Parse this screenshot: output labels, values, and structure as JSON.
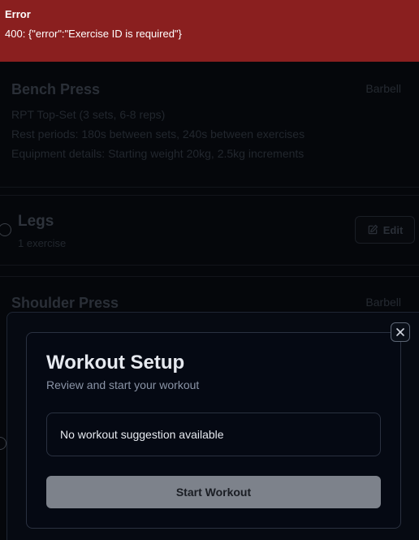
{
  "error_toast": {
    "title": "Error",
    "message": "400: {\"error\":\"Exercise ID is required\"}",
    "color": "#8a1f1f"
  },
  "background": {
    "exercise_1": {
      "name": "Bench Press",
      "equipment": "Barbell",
      "details": [
        "RPT Top-Set (3 sets, 6-8 reps)",
        "Rest periods: 180s between sets, 240s between exercises",
        "Equipment details: Starting weight 20kg, 2.5kg increments"
      ]
    },
    "group": {
      "name": "Legs",
      "count": "1 exercise",
      "edit_label": "Edit"
    },
    "exercise_2": {
      "name": "Shoulder Press",
      "equipment": "Barbell"
    }
  },
  "modal": {
    "title": "Workout Setup",
    "subtitle": "Review and start your workout",
    "suggestion_text": "No workout suggestion available",
    "start_label": "Start Workout"
  },
  "icons": {
    "close": "close-icon",
    "edit": "edit-icon"
  }
}
